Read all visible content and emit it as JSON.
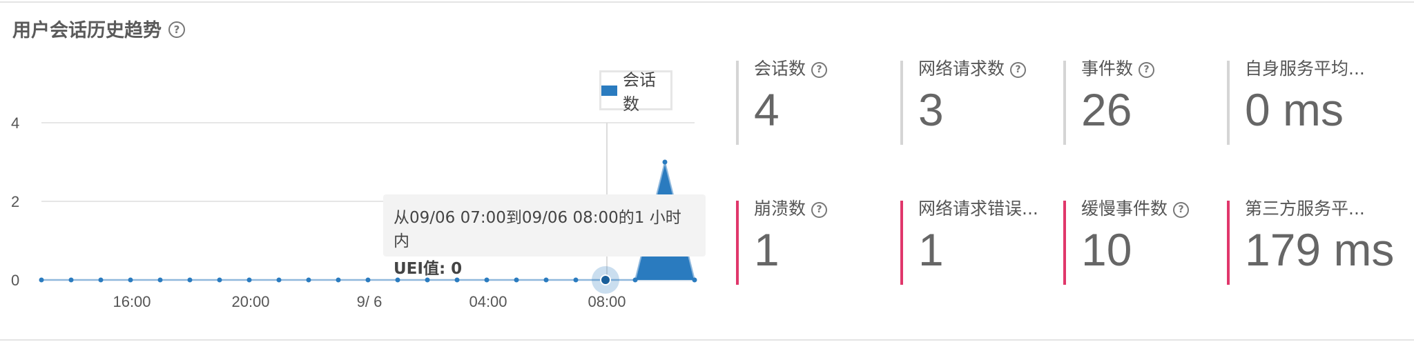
{
  "title": "用户会话历史趋势",
  "help_glyph": "?",
  "legend": {
    "label": "会话数",
    "color": "#2a7bbf"
  },
  "tooltip": {
    "line1": "从09/06 07:00到09/06 08:00的1 小时内",
    "line2": "UEI值: 0"
  },
  "chart_data": {
    "type": "area",
    "x_tick_labels": [
      "16:00",
      "20:00",
      "9/ 6",
      "04:00",
      "08:00"
    ],
    "y_tick_labels": [
      "4",
      "2",
      "0"
    ],
    "ylim": [
      0,
      4
    ],
    "grid": true,
    "legend_placement": "top-right",
    "series": [
      {
        "name": "会话数",
        "values": [
          0,
          0,
          0,
          0,
          0,
          0,
          0,
          0,
          0,
          0,
          0,
          0,
          0,
          0,
          0,
          0,
          0,
          0,
          0,
          0,
          0,
          3,
          0
        ]
      }
    ],
    "highlighted_index": 19
  },
  "metrics": [
    {
      "label": "会话数",
      "value": "4",
      "help": true,
      "accent": "gray"
    },
    {
      "label": "网络请求数",
      "value": "3",
      "help": true,
      "accent": "gray"
    },
    {
      "label": "事件数",
      "value": "26",
      "help": true,
      "accent": "gray"
    },
    {
      "label": "自身服务平均...",
      "value": "0 ms",
      "help": false,
      "accent": "gray"
    },
    {
      "label": "崩溃数",
      "value": "1",
      "help": true,
      "accent": "red"
    },
    {
      "label": "网络请求错误...",
      "value": "1",
      "help": false,
      "accent": "red"
    },
    {
      "label": "缓慢事件数",
      "value": "10",
      "help": true,
      "accent": "red"
    },
    {
      "label": "第三方服务平...",
      "value": "179 ms",
      "help": false,
      "accent": "red"
    }
  ],
  "colors": {
    "accent_red": "#e0376b",
    "accent_gray": "#d5d5d5",
    "series_blue": "#2a7bbf"
  }
}
